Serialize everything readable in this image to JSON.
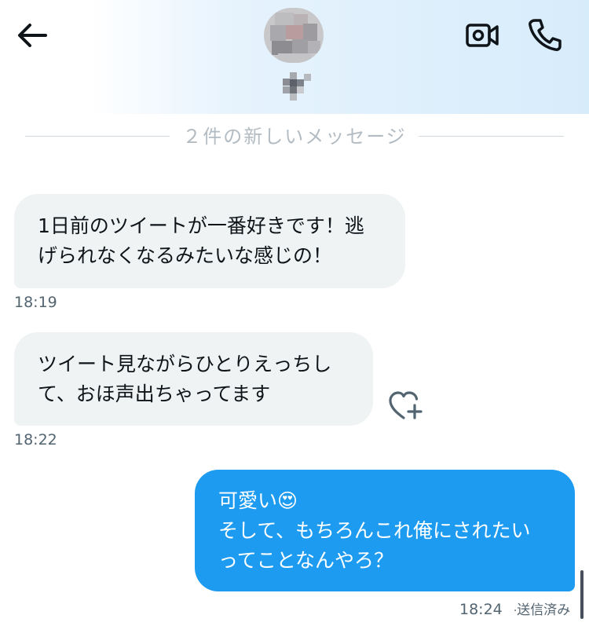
{
  "header": {
    "back_icon": "arrow-left-icon",
    "video_icon": "video-call-icon",
    "phone_icon": "phone-icon",
    "avatar": "blurred-profile-avatar",
    "icon_color": "#0f1419"
  },
  "divider": {
    "text": "２件の新しいメッセージ"
  },
  "messages": [
    {
      "direction": "received",
      "text": "1日前のツイートが一番好きです！逃\nげられなくなるみたいな感じの！",
      "time": "18:19"
    },
    {
      "direction": "received",
      "text": "ツイート見ながらひとりえっちし\nて、おほ声出ちゃってます",
      "time": "18:22",
      "reaction_icon": "heart-plus-icon"
    },
    {
      "direction": "sent",
      "text": "可愛い😍\nそして、もちろんこれ俺にされたい\nってことなんやろ？",
      "time": "18:24",
      "status": "送信済み"
    }
  ],
  "colors": {
    "sent_bubble": "#1d9bf0",
    "received_bubble": "#eff3f4",
    "timestamp": "#536471",
    "divider_text": "#b3bcc3"
  }
}
